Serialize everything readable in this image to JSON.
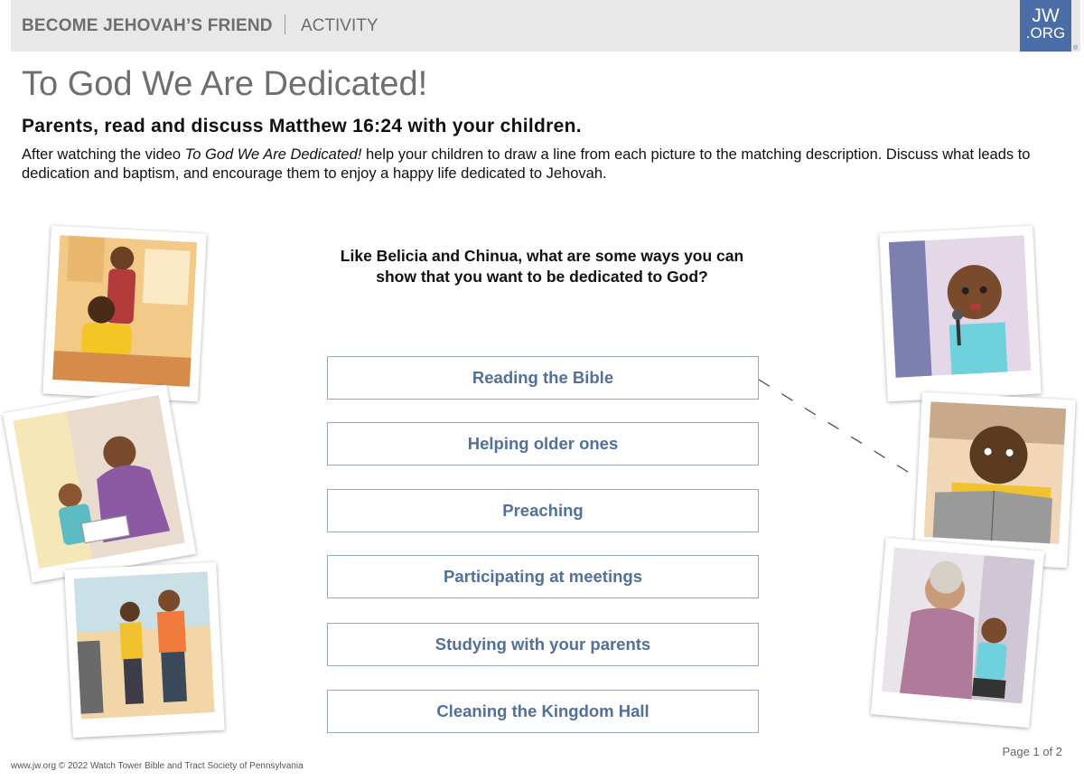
{
  "header": {
    "brand": "BECOME JEHOVAH’S FRIEND",
    "section": "ACTIVITY"
  },
  "logo": {
    "line1": "JW",
    "line2": ".ORG",
    "reg": "®"
  },
  "title": "To God We Are Dedicated!",
  "subtitle": "Parents, read and discuss Matthew 16:24 with your children.",
  "intro": {
    "before": "After watching the video ",
    "video_title": "To God We Are Dedicated!",
    "after": " help your children to draw a line from each picture to the matching description. Discuss what leads to dedication and baptism, and encourage them to enjoy a happy life dedicated to Jehovah."
  },
  "question": "Like Belicia and Chinua, what are some ways you can show that you want to be dedicated to God?",
  "answers": [
    "Reading the Bible",
    "Helping older ones",
    "Preaching",
    "Participating at meetings",
    "Studying with your parents",
    "Cleaning the Kingdom Hall"
  ],
  "footer": "www.jw.org © 2022 Watch Tower Bible and Tract Society of Pennsylvania",
  "page": "Page 1 of 2",
  "colors": {
    "accent": "#4a6da7",
    "answer_text": "#51709a",
    "title_gray": "#6d6e70"
  }
}
